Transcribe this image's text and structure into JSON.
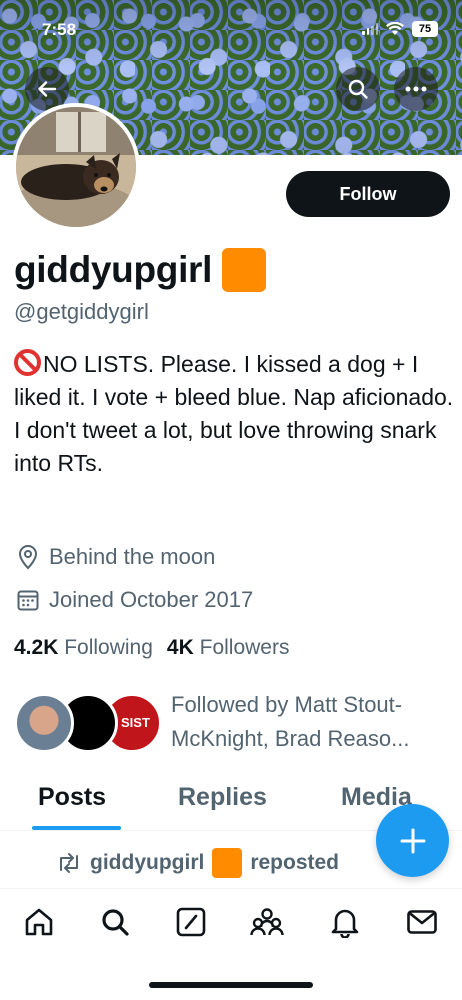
{
  "status_bar": {
    "time": "7:58",
    "battery": "75"
  },
  "profile": {
    "display_name": "giddyupgirl",
    "handle": "@getgiddygirl",
    "follow_label": "Follow",
    "bio": "NO LISTS. Please. I kissed a dog + I liked it. I vote + bleed blue. Nap aficionado. I don't tweet a lot, but love throwing snark into RTs.",
    "location": "Behind the moon",
    "joined": "Joined October 2017",
    "following_count": "4.2K",
    "following_label": "Following",
    "followers_count": "4K",
    "followers_label": "Followers",
    "followed_by_line1": "Followed by Matt Stout-",
    "followed_by_line2": "McKnight, Brad Reaso...",
    "followed_avatar_badge": "SIST"
  },
  "tabs": [
    {
      "label": "Posts",
      "active": true
    },
    {
      "label": "Replies",
      "active": false
    },
    {
      "label": "Media",
      "active": false
    }
  ],
  "feed": {
    "repost_user": "giddyupgirl",
    "repost_label": "reposted"
  },
  "colors": {
    "accent": "#1d9bf0",
    "text": "#0f1419",
    "muted": "#536471",
    "badge": "#ff8c00"
  },
  "icons": [
    "back-arrow-icon",
    "search-icon",
    "more-icon",
    "location-pin-icon",
    "calendar-icon",
    "repost-icon",
    "plus-icon",
    "home-icon",
    "explore-icon",
    "grok-icon",
    "communities-icon",
    "notifications-icon",
    "messages-icon"
  ]
}
